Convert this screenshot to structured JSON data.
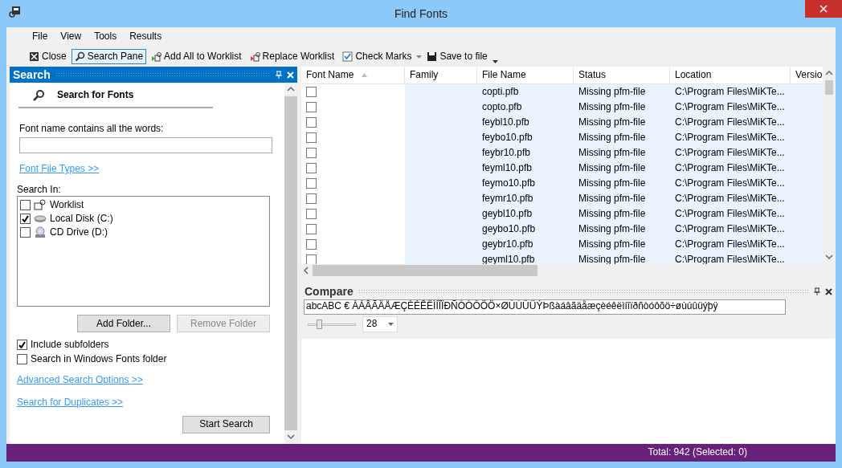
{
  "window": {
    "title": "Find Fonts"
  },
  "menu": [
    "File",
    "View",
    "Tools",
    "Results"
  ],
  "toolbar": [
    {
      "kind": "close",
      "label": "Close",
      "selected": false
    },
    {
      "kind": "search",
      "label": "Search Pane",
      "selected": true
    },
    {
      "kind": "add",
      "label": "Add All to Worklist",
      "selected": false
    },
    {
      "kind": "replace",
      "label": "Replace Worklist",
      "selected": false
    },
    {
      "kind": "check",
      "label": "Check Marks",
      "selected": false
    },
    {
      "kind": "save",
      "label": "Save to file",
      "selected": false
    }
  ],
  "search_pane": {
    "title": "Search",
    "heading": "Search for Fonts",
    "name_label": "Font name contains all the words:",
    "file_types_link": "Font File Types >>",
    "search_in_label": "Search In:",
    "locations": [
      {
        "kind": "worklist",
        "label": "Worklist",
        "checked": false
      },
      {
        "kind": "disk",
        "label": "Local Disk (C:)",
        "checked": true
      },
      {
        "kind": "cd",
        "label": "CD Drive (D:)",
        "checked": false
      }
    ],
    "buttons": [
      {
        "label": "Add Folder...",
        "disabled": false
      },
      {
        "label": "Remove Folder",
        "disabled": true
      }
    ],
    "options": [
      {
        "label": "Include subfolders",
        "checked": true
      },
      {
        "label": "Search in Windows Fonts folder",
        "checked": false
      }
    ],
    "links": [
      "Advanced Search Options >>",
      "Search for Duplicates >>"
    ],
    "start_button": "Start Search"
  },
  "table": {
    "columns": [
      "Font Name",
      "Family",
      "File Name",
      "Status",
      "Location",
      "Versio"
    ],
    "rows": [
      {
        "checked": false,
        "file": "copti.pfb",
        "status": "Missing pfm-file",
        "location": "C:\\Program Files\\MiKTe..."
      },
      {
        "checked": false,
        "file": "copto.pfb",
        "status": "Missing pfm-file",
        "location": "C:\\Program Files\\MiKTe..."
      },
      {
        "checked": false,
        "file": "feybl10.pfb",
        "status": "Missing pfm-file",
        "location": "C:\\Program Files\\MiKTe..."
      },
      {
        "checked": false,
        "file": "feybo10.pfb",
        "status": "Missing pfm-file",
        "location": "C:\\Program Files\\MiKTe..."
      },
      {
        "checked": false,
        "file": "feybr10.pfb",
        "status": "Missing pfm-file",
        "location": "C:\\Program Files\\MiKTe..."
      },
      {
        "checked": false,
        "file": "feyml10.pfb",
        "status": "Missing pfm-file",
        "location": "C:\\Program Files\\MiKTe..."
      },
      {
        "checked": false,
        "file": "feymo10.pfb",
        "status": "Missing pfm-file",
        "location": "C:\\Program Files\\MiKTe..."
      },
      {
        "checked": false,
        "file": "feymr10.pfb",
        "status": "Missing pfm-file",
        "location": "C:\\Program Files\\MiKTe..."
      },
      {
        "checked": false,
        "file": "geybl10.pfb",
        "status": "Missing pfm-file",
        "location": "C:\\Program Files\\MiKTe..."
      },
      {
        "checked": false,
        "file": "geybo10.pfb",
        "status": "Missing pfm-file",
        "location": "C:\\Program Files\\MiKTe..."
      },
      {
        "checked": false,
        "file": "geybr10.pfb",
        "status": "Missing pfm-file",
        "location": "C:\\Program Files\\MiKTe..."
      },
      {
        "checked": false,
        "file": "geyml10.pfb",
        "status": "Missing pfm-file",
        "location": "C:\\Program Files\\MiKTe..."
      }
    ]
  },
  "compare": {
    "title": "Compare",
    "sample": "abcABC € ÀÁÂÃÄÅÆÇÈÉÊËÌÍÎÏÐÑÒÓÔÕÖ×ØÙÚÛÜÝÞßàáâãäåæçèéêëìíîïðñòóôõö÷øùúûüýþÿ",
    "size": "28",
    "level": 0.2
  },
  "status_bar": "Total: 942 (Selected: 0)"
}
